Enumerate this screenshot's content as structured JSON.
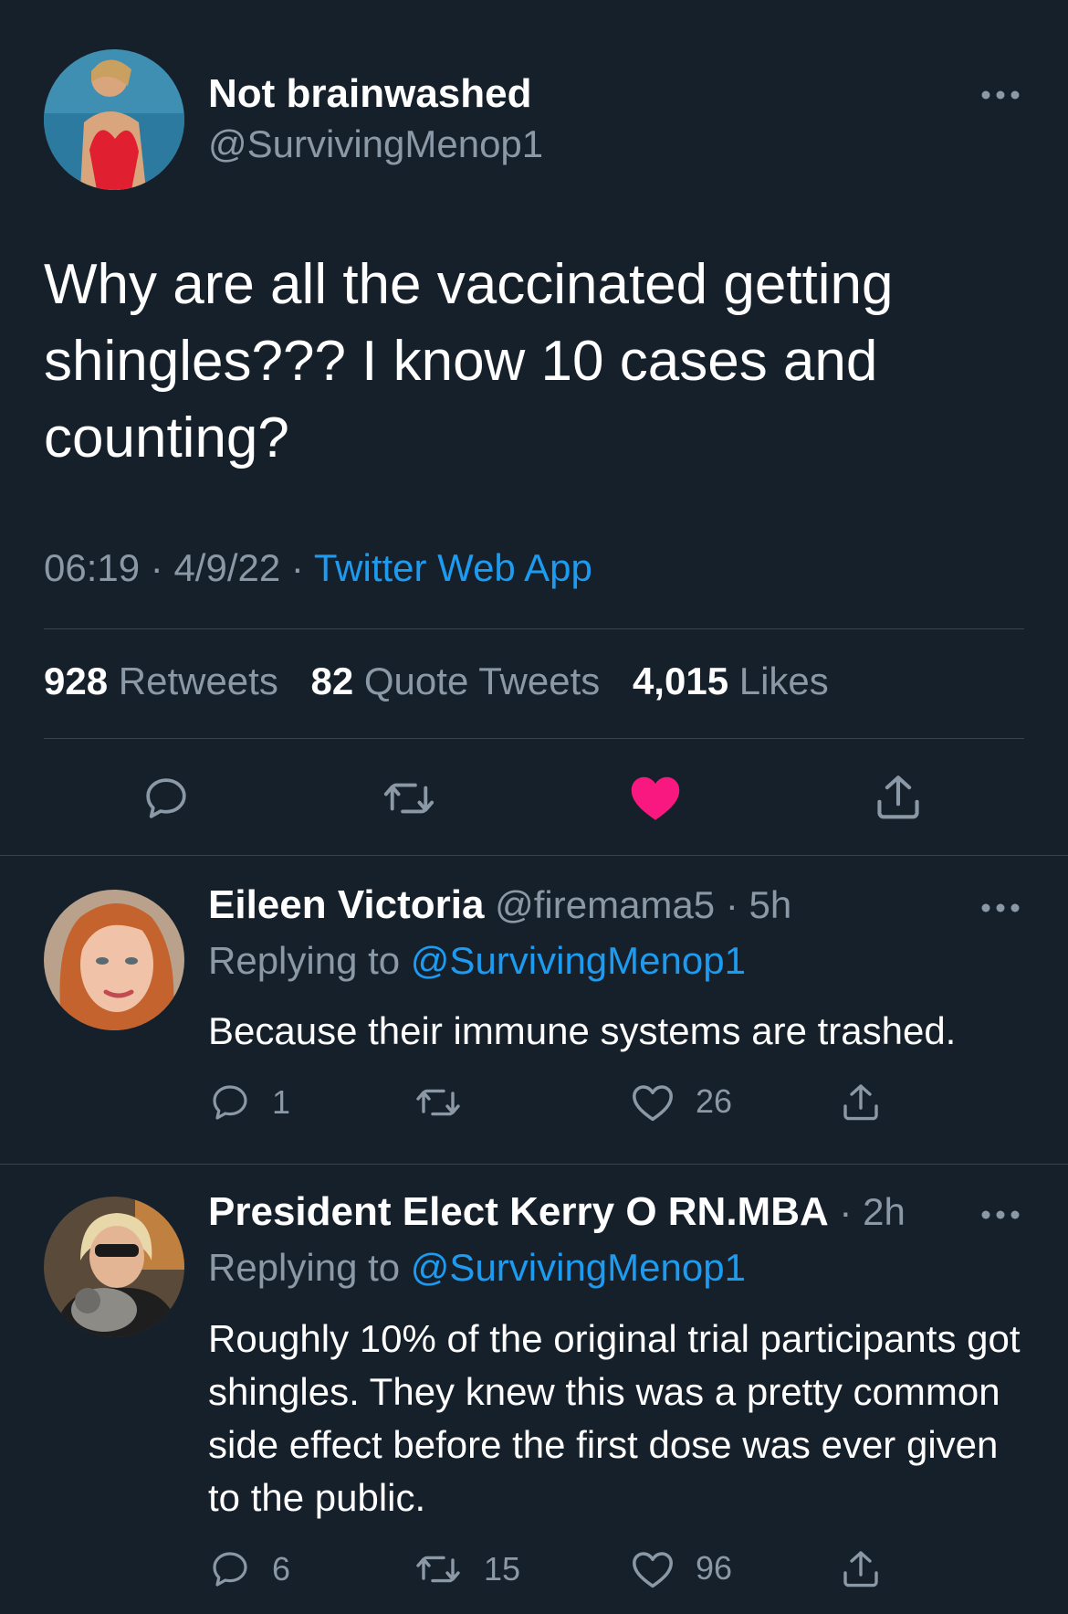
{
  "colors": {
    "background": "#15202b",
    "divider": "#38444d",
    "secondary_text": "#8b98a5",
    "link": "#1d9bf0",
    "like_active": "#f91880"
  },
  "main_tweet": {
    "author_name": "Not brainwashed",
    "author_handle": "@SurvivingMenop1",
    "text": "Why are all the vaccinated getting shingles???  I know 10 cases and counting?",
    "time": "06:19",
    "date": "4/9/22",
    "separator": "·",
    "source": "Twitter Web App",
    "stats": {
      "retweets_count": "928",
      "retweets_label": "Retweets",
      "quotes_count": "82",
      "quotes_label": "Quote Tweets",
      "likes_count": "4,015",
      "likes_label": "Likes"
    },
    "actions": [
      "reply-icon",
      "retweet-icon",
      "like-icon-filled",
      "share-icon"
    ],
    "liked": true
  },
  "replies": [
    {
      "author_name": "Eileen Victoria",
      "author_handle": "@firemama5",
      "age": "5h",
      "replying_label": "Replying to",
      "replying_to": "@SurvivingMenop1",
      "text": "Because their immune systems are trashed.",
      "reply_count": "1",
      "retweet_count": "",
      "like_count": "26"
    },
    {
      "author_name": "President Elect Kerry O RN.MBA",
      "author_handle": "",
      "age": "2h",
      "replying_label": "Replying to",
      "replying_to": "@SurvivingMenop1",
      "text": "Roughly 10% of the original trial participants got shingles. They knew this was a pretty common side effect before the first dose was ever given to the public.",
      "reply_count": "6",
      "retweet_count": "15",
      "like_count": "96"
    }
  ]
}
